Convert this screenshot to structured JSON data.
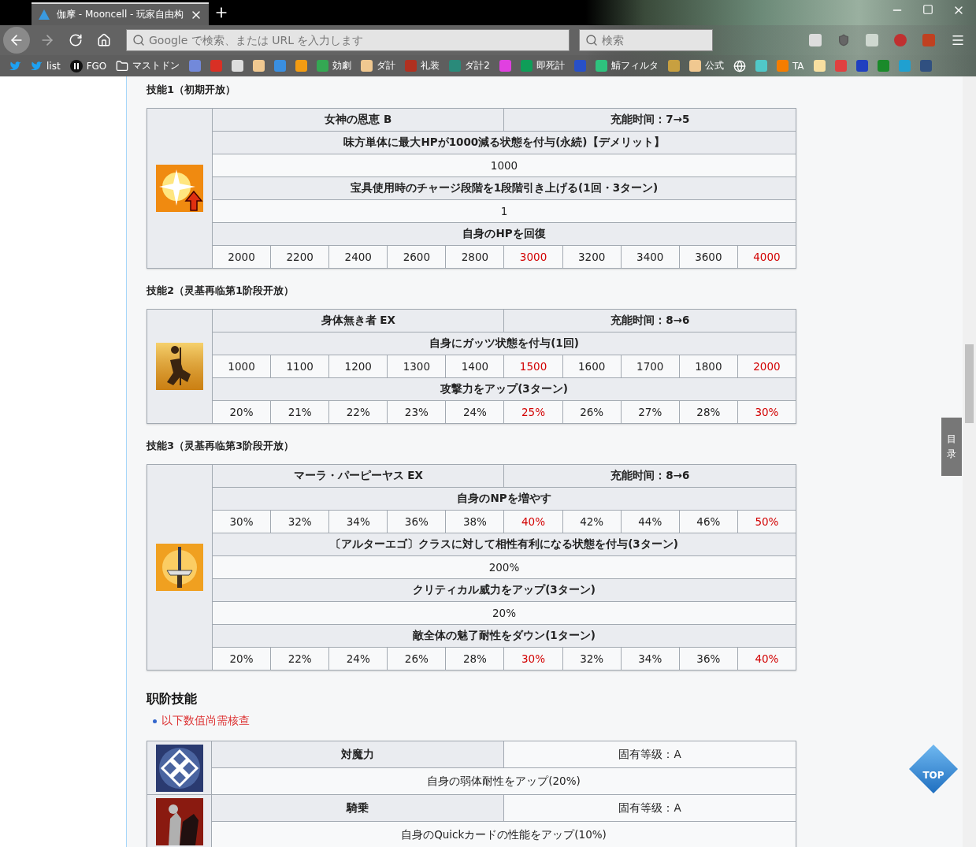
{
  "browser": {
    "tab": {
      "title": "伽摩 - Mooncell - 玩家自由构"
    },
    "address_bar": {
      "placeholder": "Google で検索、または URL を入力します"
    },
    "search_bar": {
      "placeholder": "検索"
    },
    "bookmarks": [
      {
        "kind": "bird"
      },
      {
        "kind": "bird",
        "label": "list"
      },
      {
        "kind": "circle",
        "label": "FGO"
      },
      {
        "kind": "folder",
        "label": "マストドン"
      },
      {
        "kind": "tile",
        "color": "#7289da"
      },
      {
        "kind": "tile",
        "color": "#d93025"
      },
      {
        "kind": "tile",
        "color": "#dddddd"
      },
      {
        "kind": "tile",
        "color": "#f0c890"
      },
      {
        "kind": "tile",
        "color": "#3a8fe0"
      },
      {
        "kind": "tile",
        "color": "#f39c12"
      },
      {
        "kind": "tile",
        "color": "#34a853",
        "label": "効劇"
      },
      {
        "kind": "tile",
        "color": "#f0c890",
        "label": "ダ計"
      },
      {
        "kind": "tile",
        "color": "#b03020",
        "label": "礼装"
      },
      {
        "kind": "tile",
        "color": "#2a8a7a",
        "label": "ダ計2"
      },
      {
        "kind": "tile",
        "color": "#e040e0"
      },
      {
        "kind": "tile",
        "color": "#0f9d58",
        "label": "即死計"
      },
      {
        "kind": "tile",
        "color": "#2850c8"
      },
      {
        "kind": "tile",
        "color": "#2ec27e",
        "label": "鯖フィルタ"
      },
      {
        "kind": "tile",
        "color": "#c8a040"
      },
      {
        "kind": "tile",
        "color": "#f0c890",
        "label": "公式"
      },
      {
        "kind": "globe"
      },
      {
        "kind": "tile",
        "color": "#50c8c8"
      },
      {
        "kind": "tile",
        "color": "#f57d00",
        "label": "TA"
      },
      {
        "kind": "tile",
        "color": "#f8e0a0"
      },
      {
        "kind": "tile",
        "color": "#e04040"
      },
      {
        "kind": "tile",
        "color": "#2040c0"
      },
      {
        "kind": "tile",
        "color": "#1a8a2a"
      },
      {
        "kind": "tile",
        "color": "#20a0d0"
      },
      {
        "kind": "tile",
        "color": "#305080"
      }
    ]
  },
  "skills": [
    {
      "heading": "技能1（初期开放）",
      "kind": "sparkle",
      "name": "女神の恩恵 B",
      "cooldown": "充能时间：7→5",
      "effects": [
        {
          "effect": "味方単体に最大HPが1000減る状態を付与(永続)【デメリット】",
          "values": [
            {
              "text": "1000",
              "highlighted": false
            }
          ]
        },
        {
          "effect": "宝具使用時のチャージ段階を1段階引き上げる(1回・3ターン)",
          "values": [
            {
              "text": "1",
              "highlighted": false
            }
          ]
        },
        {
          "effect": "自身のHPを回復",
          "values": [
            {
              "text": "2000",
              "highlighted": false
            },
            {
              "text": "2200",
              "highlighted": false
            },
            {
              "text": "2400",
              "highlighted": false
            },
            {
              "text": "2600",
              "highlighted": false
            },
            {
              "text": "2800",
              "highlighted": false
            },
            {
              "text": "3000",
              "highlighted": true
            },
            {
              "text": "3200",
              "highlighted": false
            },
            {
              "text": "3400",
              "highlighted": false
            },
            {
              "text": "3600",
              "highlighted": false
            },
            {
              "text": "4000",
              "highlighted": true
            }
          ]
        }
      ]
    },
    {
      "heading": "技能2（灵基再临第1阶段开放）",
      "kind": "kneel",
      "name": "身体無き者 EX",
      "cooldown": "充能时间：8→6",
      "effects": [
        {
          "effect": "自身にガッツ状態を付与(1回)",
          "values": [
            {
              "text": "1000",
              "highlighted": false
            },
            {
              "text": "1100",
              "highlighted": false
            },
            {
              "text": "1200",
              "highlighted": false
            },
            {
              "text": "1300",
              "highlighted": false
            },
            {
              "text": "1400",
              "highlighted": false
            },
            {
              "text": "1500",
              "highlighted": true
            },
            {
              "text": "1600",
              "highlighted": false
            },
            {
              "text": "1700",
              "highlighted": false
            },
            {
              "text": "1800",
              "highlighted": false
            },
            {
              "text": "2000",
              "highlighted": true
            }
          ]
        },
        {
          "effect": "攻撃力をアップ(3ターン)",
          "values": [
            {
              "text": "20%",
              "highlighted": false
            },
            {
              "text": "21%",
              "highlighted": false
            },
            {
              "text": "22%",
              "highlighted": false
            },
            {
              "text": "23%",
              "highlighted": false
            },
            {
              "text": "24%",
              "highlighted": false
            },
            {
              "text": "25%",
              "highlighted": true
            },
            {
              "text": "26%",
              "highlighted": false
            },
            {
              "text": "27%",
              "highlighted": false
            },
            {
              "text": "28%",
              "highlighted": false
            },
            {
              "text": "30%",
              "highlighted": true
            }
          ]
        }
      ]
    },
    {
      "heading": "技能3（灵基再临第3阶段开放）",
      "kind": "sword",
      "name": "マーラ・パーピーヤス EX",
      "cooldown": "充能时间：8→6",
      "effects": [
        {
          "effect": "自身のNPを増やす",
          "values": [
            {
              "text": "30%",
              "highlighted": false
            },
            {
              "text": "32%",
              "highlighted": false
            },
            {
              "text": "34%",
              "highlighted": false
            },
            {
              "text": "36%",
              "highlighted": false
            },
            {
              "text": "38%",
              "highlighted": false
            },
            {
              "text": "40%",
              "highlighted": true
            },
            {
              "text": "42%",
              "highlighted": false
            },
            {
              "text": "44%",
              "highlighted": false
            },
            {
              "text": "46%",
              "highlighted": false
            },
            {
              "text": "50%",
              "highlighted": true
            }
          ]
        },
        {
          "effect": "〔アルターエゴ〕クラスに対して相性有利になる状態を付与(3ターン)",
          "values": [
            {
              "text": "200%",
              "highlighted": false
            }
          ]
        },
        {
          "effect": "クリティカル威力をアップ(3ターン)",
          "values": [
            {
              "text": "20%",
              "highlighted": false
            }
          ]
        },
        {
          "effect": "敵全体の魅了耐性をダウン(1ターン)",
          "values": [
            {
              "text": "20%",
              "highlighted": false
            },
            {
              "text": "22%",
              "highlighted": false
            },
            {
              "text": "24%",
              "highlighted": false
            },
            {
              "text": "26%",
              "highlighted": false
            },
            {
              "text": "28%",
              "highlighted": false
            },
            {
              "text": "30%",
              "highlighted": true
            },
            {
              "text": "32%",
              "highlighted": false
            },
            {
              "text": "34%",
              "highlighted": false
            },
            {
              "text": "36%",
              "highlighted": false
            },
            {
              "text": "40%",
              "highlighted": true
            }
          ]
        }
      ]
    }
  ],
  "class_skills": {
    "heading": "职阶技能",
    "notes": [
      "以下数值尚需核查"
    ],
    "items": [
      {
        "kind": "diamond",
        "name": "対魔力",
        "rank": "固有等级：A",
        "effect": "自身の弱体耐性をアップ(20%)"
      },
      {
        "kind": "rider",
        "name": "騎乗",
        "rank": "固有等级：A",
        "effect": "自身のQuickカードの性能をアップ(10%)"
      }
    ]
  },
  "side_tab": {
    "label": "目录"
  },
  "top_button": {
    "label": "TOP"
  }
}
